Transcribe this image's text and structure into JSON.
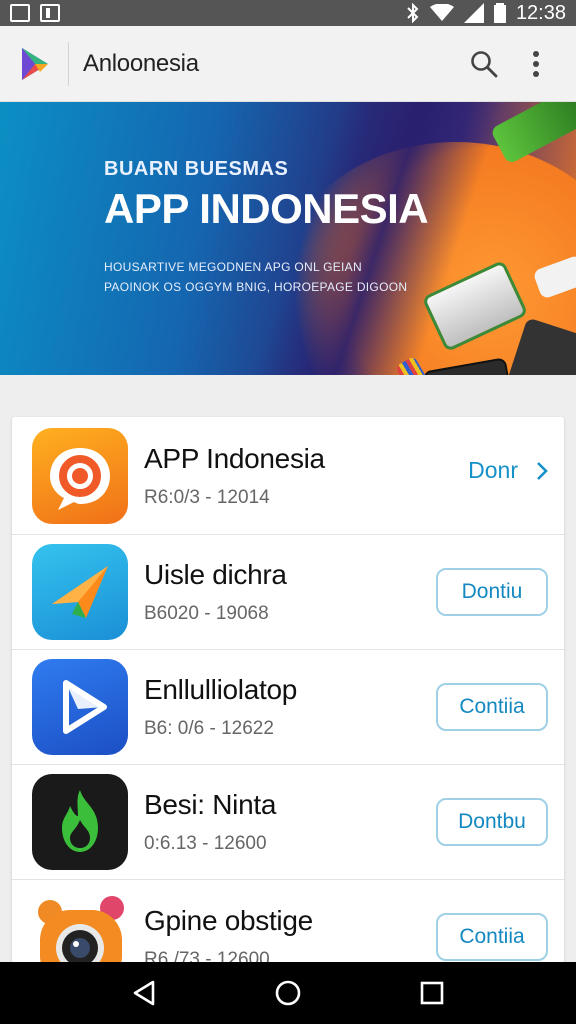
{
  "status_bar": {
    "time": "12:38"
  },
  "app_bar": {
    "title": "Anloonesia"
  },
  "banner": {
    "subtitle": "BUARN BUESMAS",
    "headline": "APP INDONESIA",
    "desc_line1": "HOUSARTIVE MEGODNEN APG ONL GEIAN",
    "desc_line2": "PAOINOK OS OGGYM BNIG, HOROEPAGE DIGOON"
  },
  "apps": [
    {
      "name": "APP Indonesia",
      "meta": "R6:0/3 - 12014",
      "action": "Donr"
    },
    {
      "name": "Uisle dichra",
      "meta": "B6020 - 19068",
      "action": "Dontiu"
    },
    {
      "name": "Enllulliolatop",
      "meta": "B6: 0/6 - 12622",
      "action": "Contiia"
    },
    {
      "name": "Besi: Ninta",
      "meta": "0:6.13 - 12600",
      "action": "Dontbu"
    },
    {
      "name": "Gpine obstige",
      "meta": "R6./73 - 12600",
      "action": "Contiia"
    }
  ],
  "colors": {
    "accent": "#1590c8",
    "status_bar": "#555555",
    "nav_bar": "#000000"
  }
}
